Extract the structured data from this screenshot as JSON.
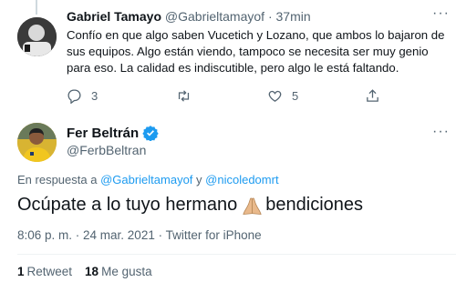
{
  "reply_tweet": {
    "author_name": "Gabriel Tamayo",
    "author_handle": "@Gabrieltamayof",
    "separator": "·",
    "time": "37min",
    "text": "Confío en que algo saben Vucetich y Lozano, que ambos lo bajaron de sus equipos. Algo están viendo, tampoco se necesita ser muy genio para eso. La calidad es indiscutible, pero algo le está faltando.",
    "reply_count": "3",
    "like_count": "5"
  },
  "main_tweet": {
    "author_name": "Fer Beltrán",
    "author_handle": "@FerbBeltran",
    "in_reply_prefix": "En respuesta a ",
    "mention_1": "@Gabrieltamayof",
    "mention_join": " y ",
    "mention_2": "@nicoledomrt",
    "text_part_1": "Ocúpate a lo tuyo hermano",
    "text_part_2": "bendiciones",
    "meta": "8:06 p. m. · 24 mar. 2021 · Twitter for iPhone",
    "retweets_count": "1",
    "retweets_label": "Retweet",
    "likes_count": "18",
    "likes_label": "Me gusta"
  },
  "colors": {
    "accent": "#1d9bf0",
    "secondary_text": "#536471",
    "primary_text": "#0f1419"
  }
}
